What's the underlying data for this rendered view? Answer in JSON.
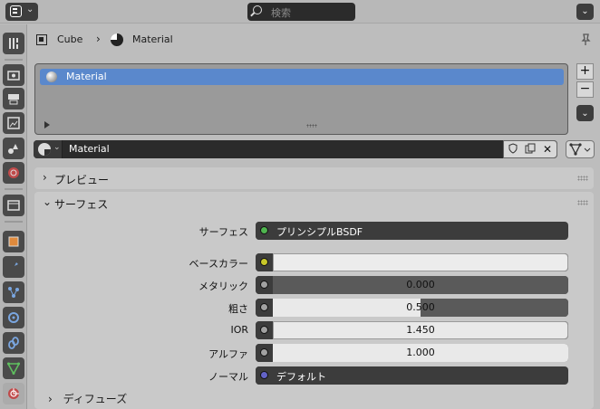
{
  "header": {
    "search_placeholder": "検索"
  },
  "tabs": [
    {
      "name": "tool-tab-icon"
    },
    {
      "name": "render-tab-icon"
    },
    {
      "name": "output-tab-icon"
    },
    {
      "name": "view-layer-tab-icon"
    },
    {
      "name": "scene-tab-icon"
    },
    {
      "name": "world-tab-icon"
    },
    {
      "name": "collection-tab-icon"
    },
    {
      "name": "object-tab-icon"
    },
    {
      "name": "modifiers-tab-icon"
    },
    {
      "name": "particles-tab-icon"
    },
    {
      "name": "physics-tab-icon"
    },
    {
      "name": "constraints-tab-icon"
    },
    {
      "name": "data-tab-icon"
    },
    {
      "name": "material-tab-icon"
    }
  ],
  "breadcrumb": {
    "object": "Cube",
    "material": "Material"
  },
  "slots": {
    "items": [
      {
        "label": "Material"
      }
    ],
    "add_label": "+",
    "remove_label": "−"
  },
  "material_bar": {
    "name": "Material",
    "close_label": "✕"
  },
  "panels": {
    "preview": {
      "title": "プレビュー"
    },
    "surface": {
      "title": "サーフェス"
    },
    "diffuse": {
      "title": "ディフューズ"
    }
  },
  "properties": [
    {
      "label": "サーフェス",
      "value": "プリンシプルBSDF",
      "socket_color": "#4fb54f",
      "kind": "shader"
    },
    {
      "label": "ベースカラー",
      "value": "",
      "socket_color": "#c7c729",
      "kind": "color",
      "swatch": "#ececec"
    },
    {
      "label": "メタリック",
      "value": "0.000",
      "socket_color": "#a1a1a1",
      "kind": "slider",
      "fraction": 0.0
    },
    {
      "label": "粗さ",
      "value": "0.500",
      "socket_color": "#a1a1a1",
      "kind": "slider",
      "fraction": 0.5
    },
    {
      "label": "IOR",
      "value": "1.450",
      "socket_color": "#a1a1a1",
      "kind": "number"
    },
    {
      "label": "アルファ",
      "value": "1.000",
      "socket_color": "#a1a1a1",
      "kind": "slider",
      "fraction": 1.0
    },
    {
      "label": "ノーマル",
      "value": "デフォルト",
      "socket_color": "#6363c7",
      "kind": "vector"
    }
  ],
  "colors": {
    "accent_selection": "#5a88cc",
    "panel_bg": "#c9c9c9"
  }
}
